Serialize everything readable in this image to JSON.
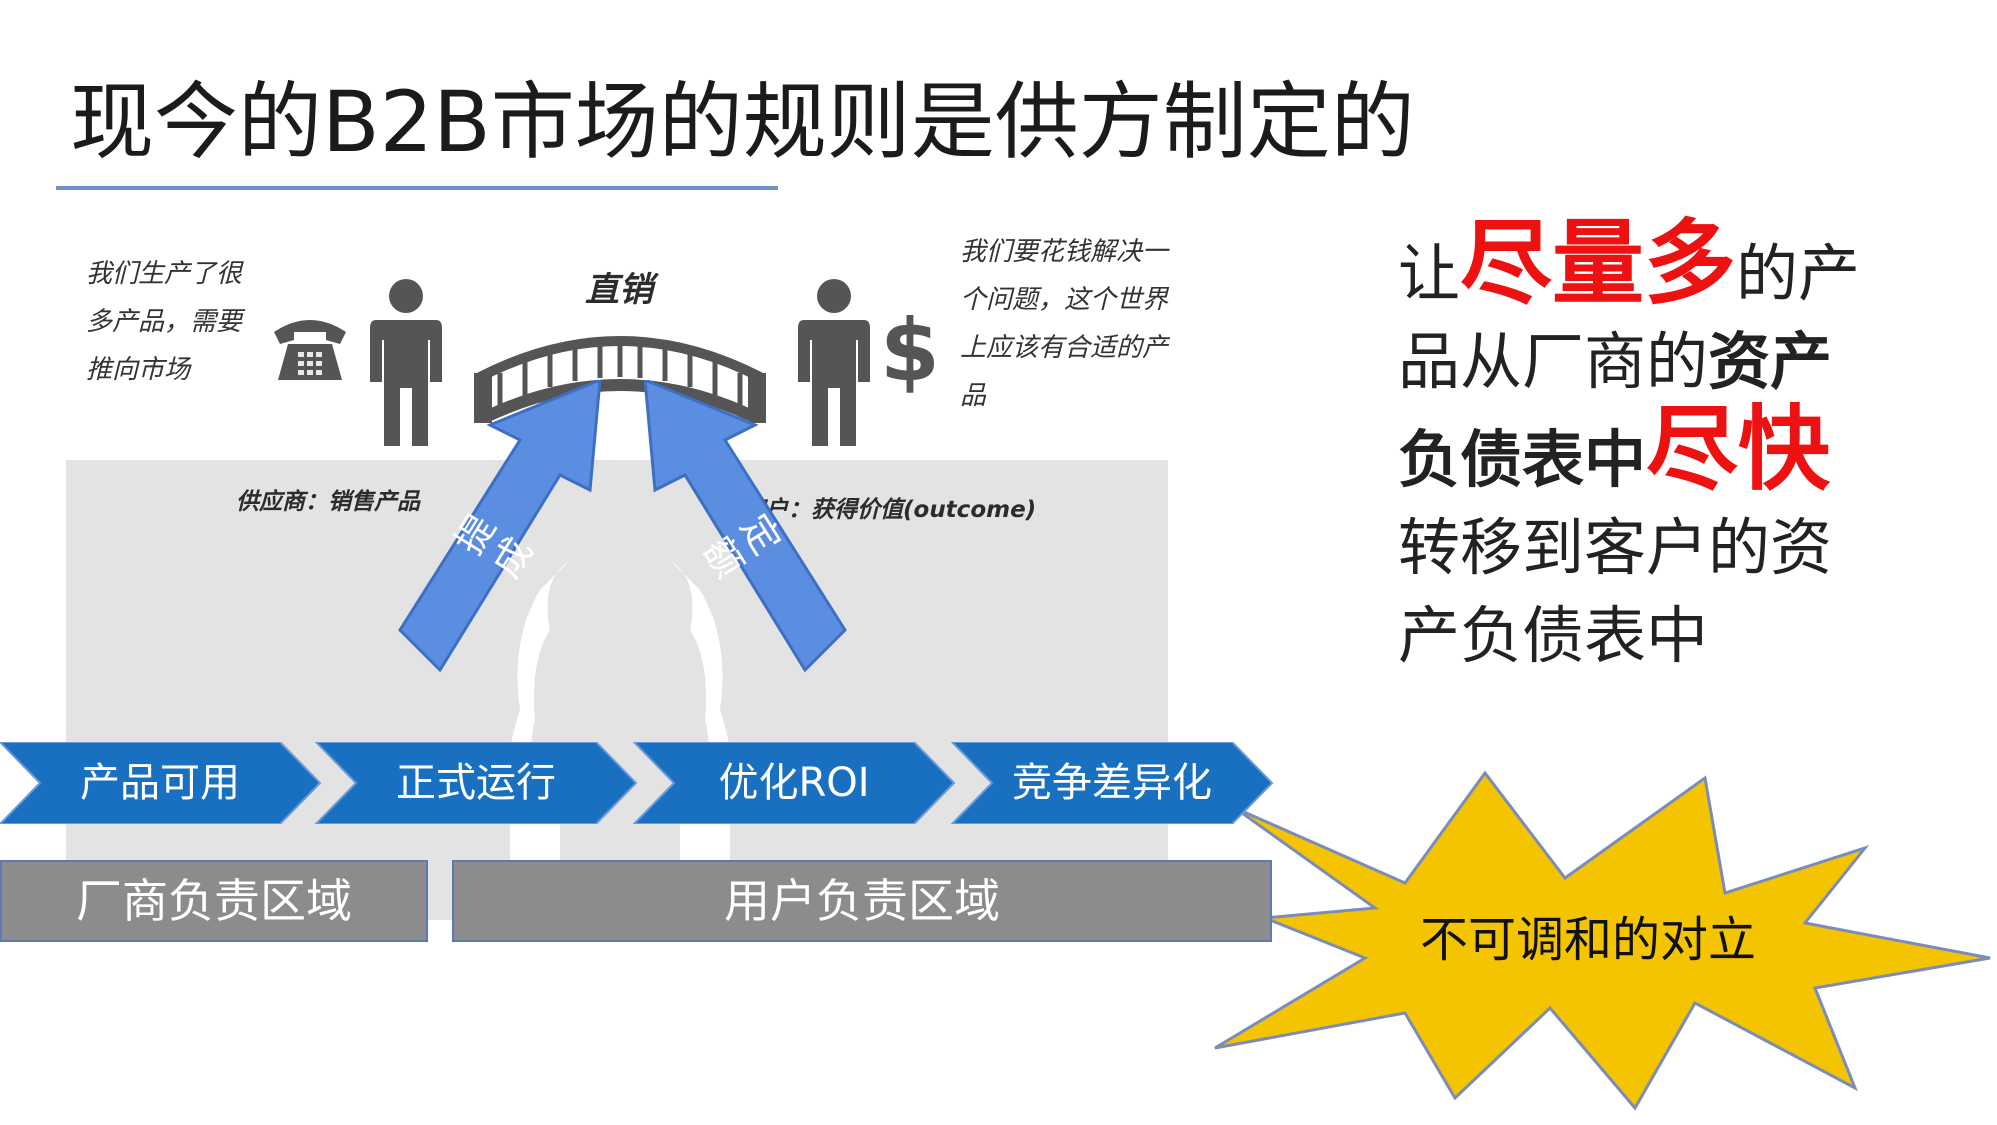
{
  "title": "现今的B2B市场的规则是供方制定的",
  "supplier_note": [
    "我们生产了很",
    "多产品，需要",
    "推向市场"
  ],
  "customer_note": [
    "我们要花钱解决一",
    "个问题，这个世界",
    "上应该有合适的产",
    "品"
  ],
  "bridge_label": "直销",
  "supplier_label": "供应商：销售产品",
  "customer_label": "客户：获得价值(outcome)",
  "dollar_symbol": "$",
  "arrows": {
    "left": "提成",
    "right": "定额"
  },
  "stages": [
    "产品可用",
    "正式运行",
    "优化ROI",
    "竞争差异化"
  ],
  "zones": {
    "vendor": "厂商负责区域",
    "user": "用户负责区域"
  },
  "conflict": "不可调和的对立",
  "side_text": {
    "l1_a": "让",
    "l1_red": "尽量多",
    "l1_b": "的产",
    "l2_a": "品从厂商的",
    "l2_bold": "资产",
    "l3_bold": "负债表中",
    "l3_red": "尽快",
    "l4": "转移到客户的资",
    "l5": "产负债表中"
  },
  "colors": {
    "chevron": "#1a70c0",
    "arrow": "#5b8ee0",
    "zone": "#8c8c8c",
    "starburst": "#f5c400",
    "accent_red": "#ee1111"
  },
  "icons": [
    "telephone-icon",
    "supplier-person-icon",
    "bridge-icon",
    "customer-person-icon",
    "dollar-icon"
  ]
}
